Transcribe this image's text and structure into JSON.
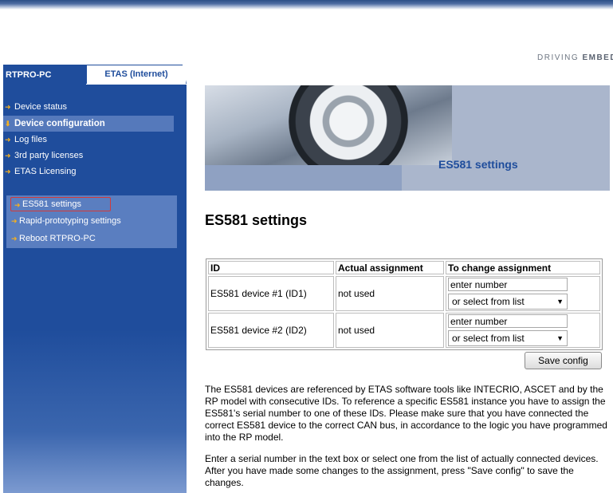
{
  "brand": {
    "text": "DRIVING ",
    "bold": "EMBEDDED"
  },
  "tabs": {
    "active": "RTPRO-PC",
    "inactive": "ETAS (Internet)"
  },
  "sidebar": {
    "items": [
      {
        "label": "Device status"
      },
      {
        "label": "Device configuration"
      },
      {
        "label": "Log files"
      },
      {
        "label": "3rd party licenses"
      },
      {
        "label": "ETAS Licensing"
      }
    ],
    "subitems": [
      {
        "label": "ES581 settings"
      },
      {
        "label": "Rapid-prototyping settings"
      },
      {
        "label": "Reboot RTPRO-PC"
      }
    ]
  },
  "banner": {
    "title": "ES581 settings"
  },
  "page_title": "ES581 settings",
  "table": {
    "headers": [
      "ID",
      "Actual assignment",
      "To change assignment"
    ],
    "rows": [
      {
        "id": "ES581 device #1 (ID1)",
        "actual": "not used",
        "input_value": "enter number",
        "select_value": "or select from list"
      },
      {
        "id": "ES581 device #2 (ID2)",
        "actual": "not used",
        "input_value": "enter number",
        "select_value": "or select from list"
      }
    ]
  },
  "save_button": "Save config",
  "paragraphs": [
    "The ES581 devices are referenced by ETAS software tools like INTECRIO, ASCET and by the RP model with consecutive IDs. To reference a specific ES581 instance you have to assign the ES581's serial number to one of these IDs. Please make sure that you have connected the correct ES581 device to the correct CAN bus, in accordance to the logic you have programmed into the RP model.",
    "Enter a serial number in the text box or select one from the list of actually connected devices. After you have made some changes to the assignment, press \"Save config\" to save the changes."
  ],
  "colors": {
    "nav_blue": "#1f4d9c",
    "nav_highlight": "#5579bb",
    "arrow": "#f4b021"
  }
}
